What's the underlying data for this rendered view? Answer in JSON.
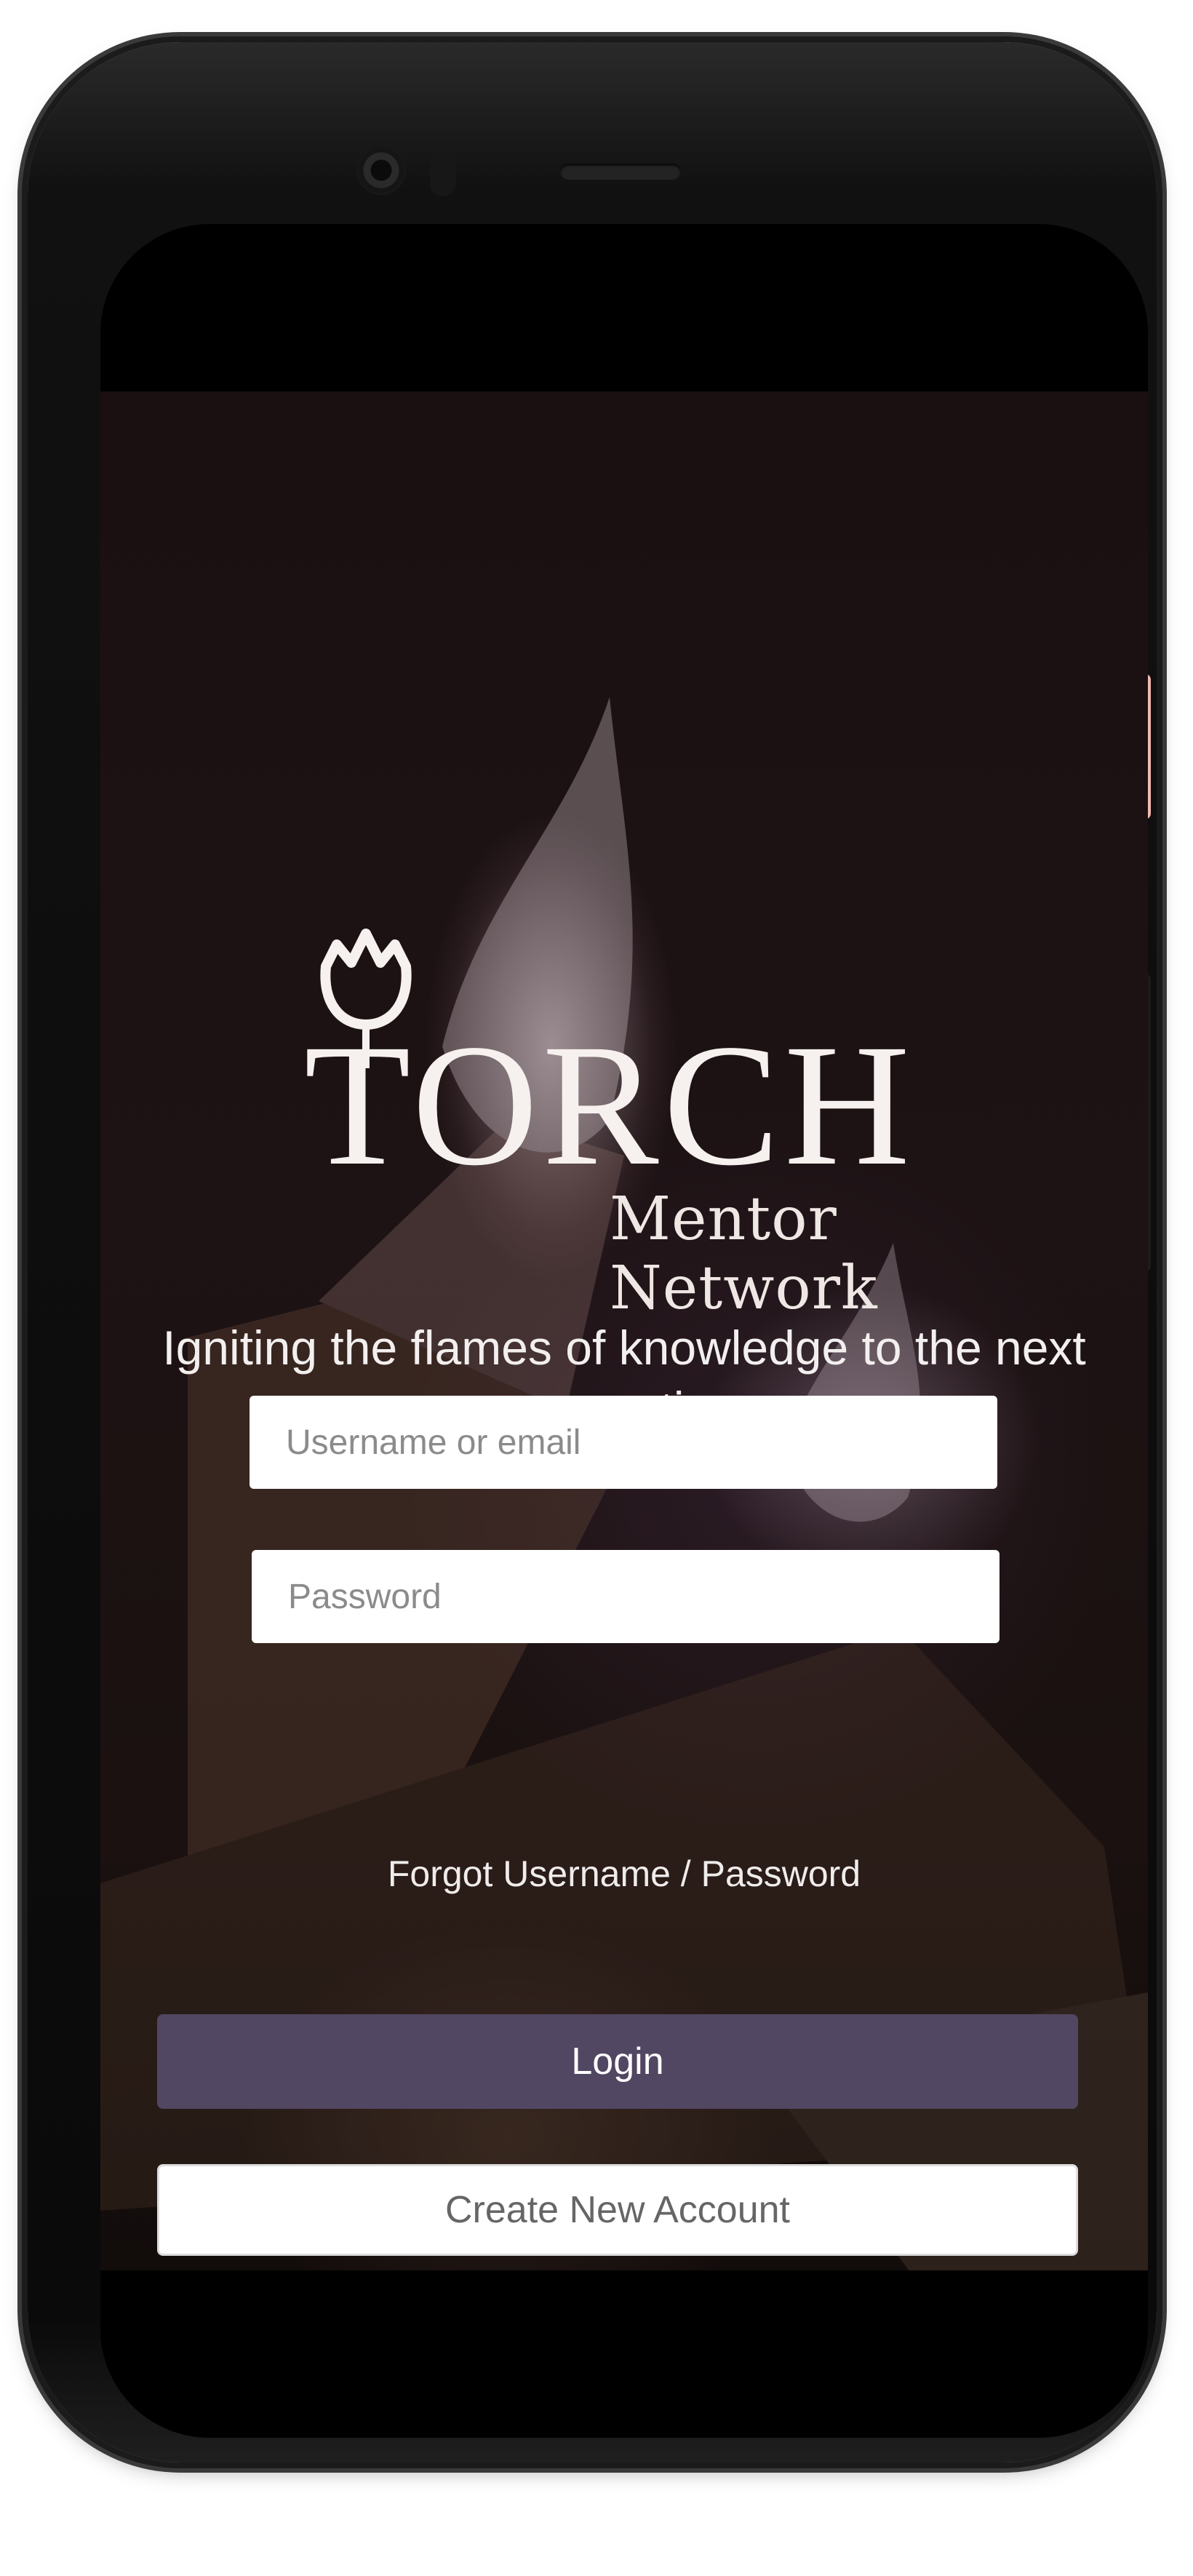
{
  "brand": {
    "name": "TORCH",
    "subtitle": "Mentor Network"
  },
  "tagline": "Igniting the flames of knowledge to the next generation",
  "login_form": {
    "username_placeholder": "Username or email",
    "password_placeholder": "Password",
    "forgot_link": "Forgot Username / Password",
    "login_button": "Login",
    "create_account_button": "Create New Account"
  },
  "colors": {
    "login_button_bg": "#514762",
    "background_dark": "#1a1012",
    "input_bg": "#ffffff"
  },
  "icons": [
    "torch-flame-logo-icon"
  ]
}
